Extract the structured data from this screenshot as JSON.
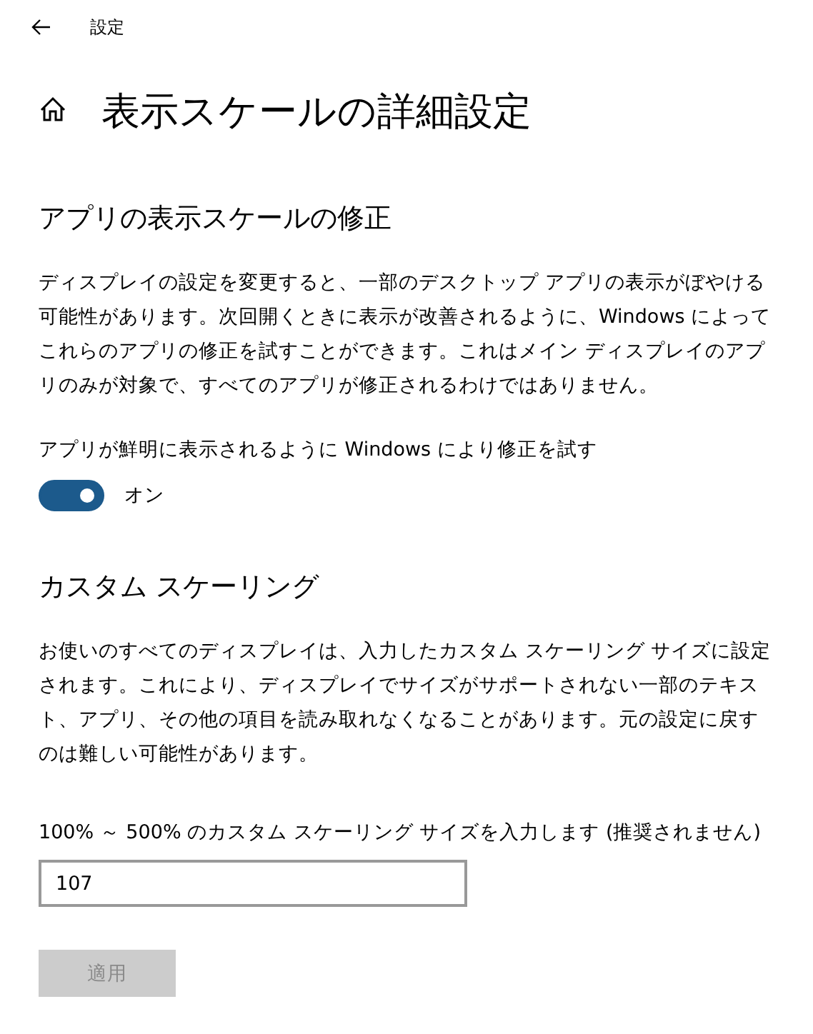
{
  "window": {
    "title": "設定"
  },
  "page": {
    "title": "表示スケールの詳細設定"
  },
  "sections": [
    {
      "kind": "toggle",
      "heading": "アプリの表示スケールの修正",
      "description": "ディスプレイの設定を変更すると、一部のデスクトップ アプリの表示がぼやける可能性があります。次回開くときに表示が改善されるように、Windows によってこれらのアプリの修正を試すことができます。これはメイン ディスプレイのアプリのみが対象で、すべてのアプリが修正されるわけではありません。",
      "label": "アプリが鮮明に表示されるように Windows により修正を試す",
      "on": true,
      "state_text": "オン"
    },
    {
      "kind": "input",
      "heading": "カスタム スケーリング",
      "description": "お使いのすべてのディスプレイは、入力したカスタム スケーリング サイズに設定されます。これにより、ディスプレイでサイズがサポートされない一部のテキスト、アプリ、その他の項目を読み取れなくなることがあります。元の設定に戻すのは難しい可能性があります。",
      "label": "100% ～ 500% のカスタム スケーリング サイズを入力します (推奨されません)",
      "value": "107",
      "button": {
        "label": "適用",
        "disabled": true
      }
    }
  ]
}
